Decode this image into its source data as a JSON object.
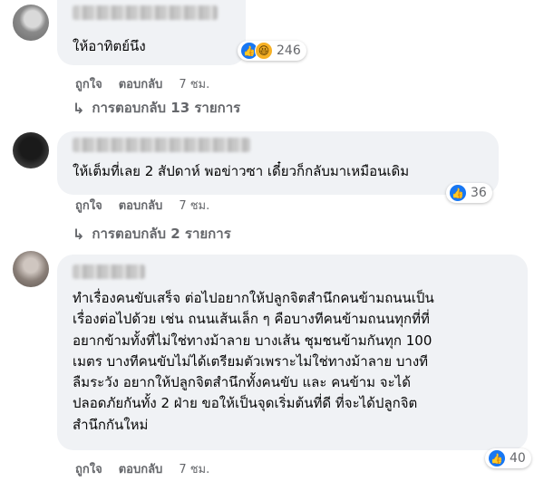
{
  "comments": [
    {
      "text": "ให้อาทิตย์นึง",
      "reactions": {
        "icons": [
          "like-icon",
          "haha-icon"
        ],
        "count": "246"
      },
      "actions": {
        "like": "ถูกใจ",
        "reply": "ตอบกลับ",
        "time": "7 ชม."
      },
      "replies_label": "การตอบกลับ 13 รายการ"
    },
    {
      "text": "ให้เต็มที่เลย 2 สัปดาห์ พอข่าวซา เดี๋ยวก็กลับมาเหมือนเดิม",
      "reactions": {
        "icons": [
          "like-icon"
        ],
        "count": "36"
      },
      "actions": {
        "like": "ถูกใจ",
        "reply": "ตอบกลับ",
        "time": "7 ชม."
      },
      "replies_label": "การตอบกลับ 2 รายการ"
    },
    {
      "text": "ทำเรื่องคนขับเสร็จ ต่อไปอยากให้ปลูกจิตสำนึกคนข้ามถนนเป็น\nเรื่องต่อไปด้วย เช่น ถนนเส้นเล็ก ๆ คือบางทีคนข้ามถนนทุกที่ที่\nอยากข้ามทั้งที่ไม่ใช่ทางม้าลาย บางเส้น ชุมชนข้ามกันทุก 100\nเมตร บางทีคนขับไม่ได้เตรียมตัวเพราะไม่ใช่ทางม้าลาย บางที\nลืมระวัง อยากให้ปลูกจิตสำนึกทั้งคนขับ และ คนข้าม จะได้\nปลอดภัยกันทั้ง 2 ฝ่าย ขอให้เป็นจุดเริ่มต้นที่ดี ที่จะได้ปลูกจิต\nสำนึกกันใหม่",
      "reactions": {
        "icons": [
          "like-icon"
        ],
        "count": "40"
      },
      "actions": {
        "like": "ถูกใจ",
        "reply": "ตอบกลับ",
        "time": "7 ชม."
      }
    }
  ],
  "colors": {
    "bubble": "#f0f2f5",
    "secondary_text": "#65676b",
    "like_blue": "#1877f2",
    "haha_yellow": "#f7b125"
  }
}
